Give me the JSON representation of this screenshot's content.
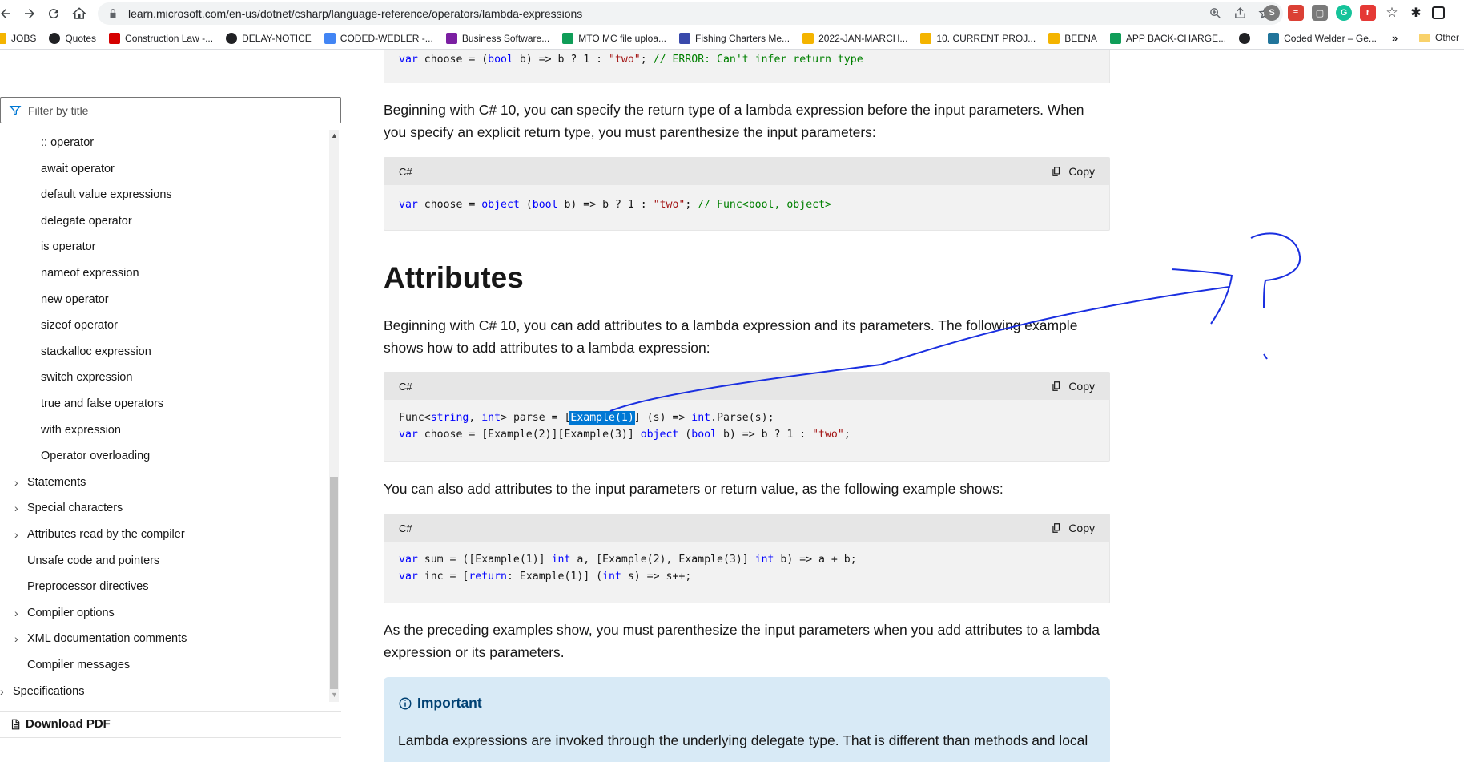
{
  "browser": {
    "url": "learn.microsoft.com/en-us/dotnet/csharp/language-reference/operators/lambda-expressions",
    "bookmarks": [
      {
        "label": "JOBS",
        "icon": "drive-icon",
        "color": "#f4b400"
      },
      {
        "label": "Quotes",
        "icon": "globe-icon",
        "color": "#202124"
      },
      {
        "label": "Construction Law -...",
        "icon": "square-icon",
        "color": "#d50000"
      },
      {
        "label": "DELAY-NOTICE",
        "icon": "globe-icon",
        "color": "#202124"
      },
      {
        "label": "CODED-WEDLER -...",
        "icon": "google-icon",
        "color": "#4285f4"
      },
      {
        "label": "Business Software...",
        "icon": "m-icon",
        "color": "#7b1fa2"
      },
      {
        "label": "MTO MC file uploa...",
        "icon": "plus-icon",
        "color": "#0f9d58"
      },
      {
        "label": "Fishing Charters Me...",
        "icon": "fish-icon",
        "color": "#3949ab"
      },
      {
        "label": "2022-JAN-MARCH...",
        "icon": "drive-icon",
        "color": "#f4b400"
      },
      {
        "label": "10. CURRENT PROJ...",
        "icon": "drive-icon",
        "color": "#f4b400"
      },
      {
        "label": "BEENA",
        "icon": "drive-icon",
        "color": "#f4b400"
      },
      {
        "label": "APP BACK-CHARGE...",
        "icon": "plus-icon",
        "color": "#0f9d58"
      },
      {
        "label": "",
        "icon": "globe-icon",
        "color": "#202124"
      },
      {
        "label": "Coded Welder – Ge...",
        "icon": "wordpress-icon",
        "color": "#21759b"
      }
    ],
    "more_label": "»",
    "other_label": "Other"
  },
  "toc": {
    "filter_placeholder": "Filter by title",
    "items": [
      {
        "label": ":: operator",
        "chevron": false
      },
      {
        "label": "await operator",
        "chevron": false
      },
      {
        "label": "default value expressions",
        "chevron": false
      },
      {
        "label": "delegate operator",
        "chevron": false
      },
      {
        "label": "is operator",
        "chevron": false
      },
      {
        "label": "nameof expression",
        "chevron": false
      },
      {
        "label": "new operator",
        "chevron": false
      },
      {
        "label": "sizeof operator",
        "chevron": false
      },
      {
        "label": "stackalloc expression",
        "chevron": false
      },
      {
        "label": "switch expression",
        "chevron": false
      },
      {
        "label": "true and false operators",
        "chevron": false
      },
      {
        "label": "with expression",
        "chevron": false
      },
      {
        "label": "Operator overloading",
        "chevron": false
      },
      {
        "label": "Statements",
        "chevron": true
      },
      {
        "label": "Special characters",
        "chevron": true
      },
      {
        "label": "Attributes read by the compiler",
        "chevron": true
      },
      {
        "label": "Unsafe code and pointers",
        "chevron": false
      },
      {
        "label": "Preprocessor directives",
        "chevron": false
      },
      {
        "label": "Compiler options",
        "chevron": true
      },
      {
        "label": "XML documentation comments",
        "chevron": true
      },
      {
        "label": "Compiler messages",
        "chevron": false
      },
      {
        "label": "Specifications",
        "chevron": true
      }
    ],
    "download_pdf": "Download PDF"
  },
  "content": {
    "para1": "Beginning with C# 10, you can specify the return type of a lambda expression before the input parameters. When you specify an explicit return type, you must parenthesize the input parameters:",
    "heading": "Attributes",
    "para2": "Beginning with C# 10, you can add attributes to a lambda expression and its parameters. The following example shows how to add attributes to a lambda expression:",
    "para3": "You can also add attributes to the input parameters or return value, as the following example shows:",
    "para4": "As the preceding examples show, you must parenthesize the input parameters when you add attributes to a lambda expression or its parameters.",
    "code_lang": "C#",
    "copy_label": "Copy",
    "important_title": "Important",
    "important_text": "Lambda expressions are invoked through the underlying delegate type. That is different than methods and local"
  }
}
